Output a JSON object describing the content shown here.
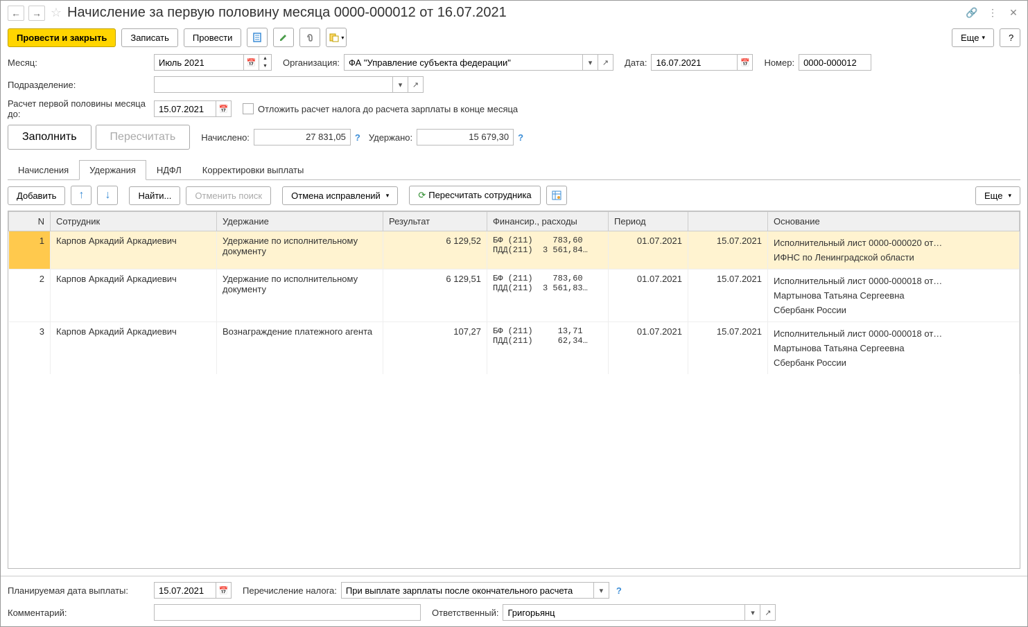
{
  "title": "Начисление за первую половину месяца 0000-000012 от 16.07.2021",
  "toolbar": {
    "submit_close": "Провести и закрыть",
    "save": "Записать",
    "submit": "Провести",
    "more": "Еще"
  },
  "form": {
    "month_label": "Месяц:",
    "month_value": "Июль 2021",
    "org_label": "Организация:",
    "org_value": "ФА \"Управление субъекта федерации\"",
    "date_label": "Дата:",
    "date_value": "16.07.2021",
    "number_label": "Номер:",
    "number_value": "0000-000012",
    "dept_label": "Подразделение:",
    "dept_value": "",
    "calc_until_label": "Расчет первой половины месяца до:",
    "calc_until_value": "15.07.2021",
    "postpone_label": "Отложить расчет налога до расчета зарплаты в конце месяца",
    "fill_btn": "Заполнить",
    "recalc_btn": "Пересчитать",
    "accrued_label": "Начислено:",
    "accrued_value": "27 831,05",
    "withheld_label": "Удержано:",
    "withheld_value": "15 679,30"
  },
  "tabs": {
    "accruals": "Начисления",
    "withholdings": "Удержания",
    "ndfl": "НДФЛ",
    "corrections": "Корректировки выплаты"
  },
  "subtoolbar": {
    "add": "Добавить",
    "find": "Найти...",
    "cancel_search": "Отменить поиск",
    "cancel_fixes": "Отмена исправлений",
    "recalc_emp": "Пересчитать сотрудника",
    "more": "Еще"
  },
  "table": {
    "headers": {
      "n": "N",
      "employee": "Сотрудник",
      "deduction": "Удержание",
      "result": "Результат",
      "financing": "Финансир., расходы",
      "period": "Период",
      "basis": "Основание"
    },
    "rows": [
      {
        "n": "1",
        "employee": "Карпов Аркадий Аркадиевич",
        "deduction": "Удержание по исполнительному документу",
        "result": "6 129,52",
        "fin_line1": "БФ (211)    783,60",
        "fin_line2": "ПДД(211)  3 561,84…",
        "period1": "01.07.2021",
        "period2": "15.07.2021",
        "basis1": "Исполнительный лист 0000-000020 от…",
        "basis2": "ИФНС по Ленинградской области",
        "basis3": ""
      },
      {
        "n": "2",
        "employee": "Карпов Аркадий Аркадиевич",
        "deduction": "Удержание по исполнительному документу",
        "result": "6 129,51",
        "fin_line1": "БФ (211)    783,60",
        "fin_line2": "ПДД(211)  3 561,83…",
        "period1": "01.07.2021",
        "period2": "15.07.2021",
        "basis1": "Исполнительный лист 0000-000018 от…",
        "basis2": "Мартынова Татьяна Сергеевна",
        "basis3": "Сбербанк России"
      },
      {
        "n": "3",
        "employee": "Карпов Аркадий Аркадиевич",
        "deduction": "Вознаграждение платежного агента",
        "result": "107,27",
        "fin_line1": "БФ (211)     13,71",
        "fin_line2": "ПДД(211)     62,34…",
        "period1": "01.07.2021",
        "period2": "15.07.2021",
        "basis1": "Исполнительный лист 0000-000018 от…",
        "basis2": "Мартынова Татьяна Сергеевна",
        "basis3": "Сбербанк России"
      }
    ]
  },
  "bottom": {
    "planned_date_label": "Планируемая дата выплаты:",
    "planned_date_value": "15.07.2021",
    "tax_transfer_label": "Перечисление налога:",
    "tax_transfer_value": "При выплате зарплаты после окончательного расчета",
    "comment_label": "Комментарий:",
    "comment_value": "",
    "responsible_label": "Ответственный:",
    "responsible_value": "Григорьянц"
  }
}
